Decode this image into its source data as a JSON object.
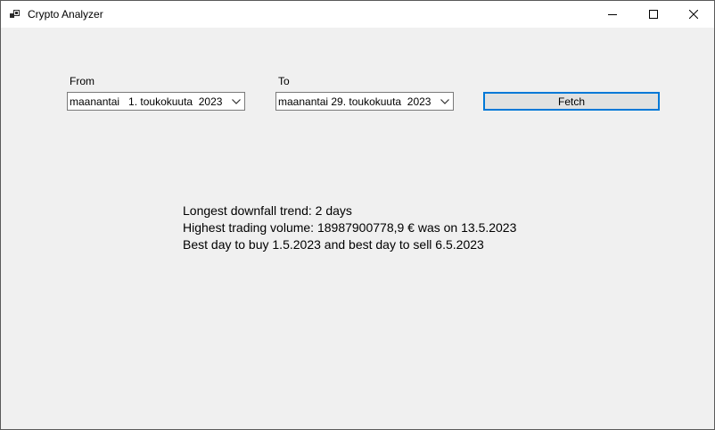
{
  "window": {
    "title": "Crypto Analyzer",
    "app_icon": "app-icon",
    "controls": {
      "minimize_icon": "minimize-icon",
      "maximize_icon": "maximize-icon",
      "close_icon": "close-icon"
    }
  },
  "form": {
    "from_label": "From",
    "from_value": "maanantai   1. toukokuuta  2023",
    "to_label": "To",
    "to_value": "maanantai 29. toukokuuta  2023",
    "dropdown_icon": "chevron-down-icon",
    "fetch_label": "Fetch"
  },
  "results": {
    "downfall": "Longest downfall trend: 2 days",
    "volume": "Highest trading volume: 18987900778,9 € was on 13.5.2023",
    "buy_sell": "Best day to buy 1.5.2023 and best day to sell 6.5.2023"
  },
  "colors": {
    "focus_border": "#0078d7",
    "window_background": "#f0f0f0",
    "titlebar_background": "#ffffff"
  }
}
